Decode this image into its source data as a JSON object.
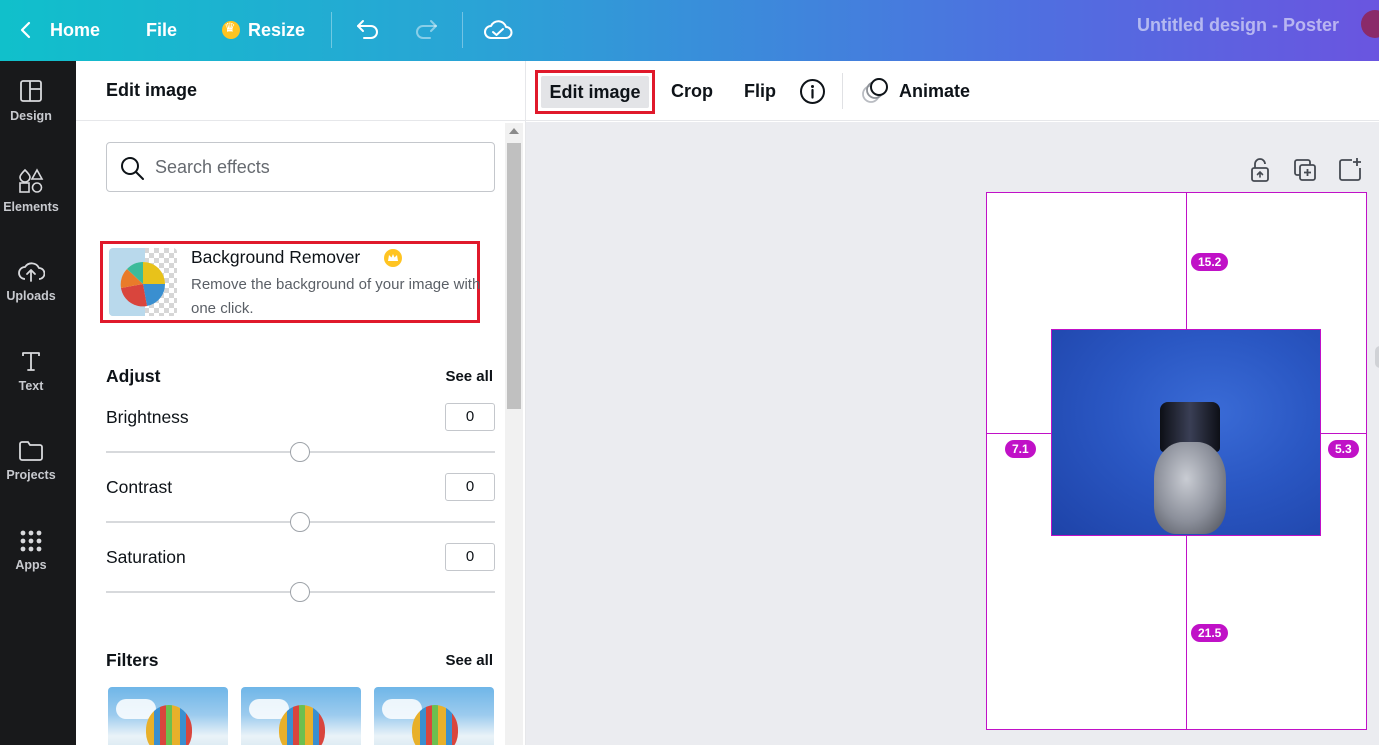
{
  "topbar": {
    "home_label": "Home",
    "file_label": "File",
    "resize_label": "Resize",
    "design_title": "Untitled design - Poster"
  },
  "rail": {
    "items": [
      {
        "label": "Design",
        "icon": "layout-icon"
      },
      {
        "label": "Elements",
        "icon": "shapes-icon"
      },
      {
        "label": "Uploads",
        "icon": "cloud-upload-icon"
      },
      {
        "label": "Text",
        "icon": "text-icon"
      },
      {
        "label": "Projects",
        "icon": "folder-icon"
      },
      {
        "label": "Apps",
        "icon": "grid-icon"
      }
    ]
  },
  "panel": {
    "title": "Edit image",
    "search_placeholder": "Search effects",
    "bg_remover": {
      "name": "Background Remover",
      "description": "Remove the background of your image with one click."
    },
    "adjust": {
      "title": "Adjust",
      "see_all": "See all",
      "items": [
        {
          "label": "Brightness",
          "value": "0"
        },
        {
          "label": "Contrast",
          "value": "0"
        },
        {
          "label": "Saturation",
          "value": "0"
        }
      ]
    },
    "filters": {
      "title": "Filters",
      "see_all": "See all"
    }
  },
  "toolbar": {
    "edit_image": "Edit image",
    "crop": "Crop",
    "flip": "Flip",
    "animate": "Animate"
  },
  "canvas": {
    "measurements": {
      "top": "15.2",
      "left": "7.1",
      "right": "5.3",
      "bottom": "21.5"
    }
  },
  "colors": {
    "accent": "#c011c7",
    "highlight": "#e0192b",
    "premium": "#ffc422"
  }
}
